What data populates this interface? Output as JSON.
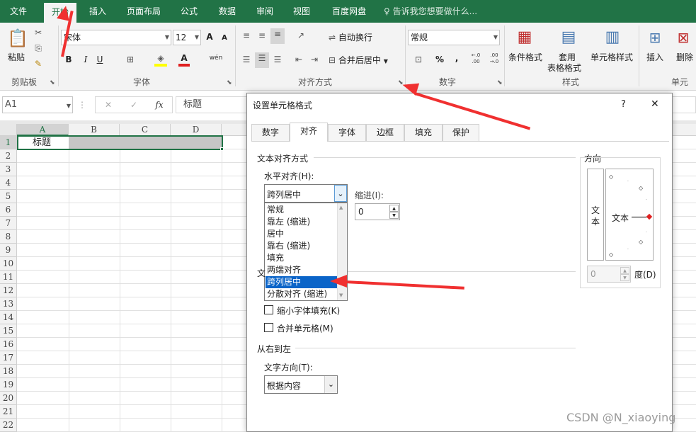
{
  "ribbon_tabs": [
    "文件",
    "开始",
    "插入",
    "页面布局",
    "公式",
    "数据",
    "审阅",
    "视图",
    "百度网盘"
  ],
  "active_tab": "开始",
  "tell_me": "告诉我您想要做什么...",
  "clipboard": {
    "paste": "粘贴",
    "group": "剪贴板"
  },
  "font": {
    "name": "宋体",
    "size": "12",
    "group": "字体",
    "bold": "B",
    "italic": "I",
    "underline": "U",
    "grow": "A",
    "shrink": "A",
    "wen": "wén"
  },
  "alignment": {
    "wrap": "自动换行",
    "merge": "合并后居中",
    "group": "对齐方式"
  },
  "number": {
    "format": "常规",
    "percent": "%",
    "comma": ",",
    "inc": "←.0 .00",
    "dec": ".00 →.0",
    "group": "数字"
  },
  "styles": {
    "cond": "条件格式",
    "table1": "套用",
    "table2": "表格格式",
    "cell": "单元格样式",
    "group": "样式"
  },
  "cells": {
    "insert": "插入",
    "delete": "删除",
    "group": "单元"
  },
  "formula_bar": {
    "name_box": "A1",
    "cancel": "✕",
    "enter": "✓",
    "fx": "fx",
    "value": "标题"
  },
  "sheet": {
    "columns": [
      "A",
      "B",
      "C",
      "D"
    ],
    "rows": [
      "1",
      "2",
      "3",
      "4",
      "5",
      "6",
      "7",
      "8",
      "9",
      "10",
      "11",
      "12",
      "13",
      "14",
      "15",
      "16",
      "17",
      "18",
      "19",
      "20",
      "21",
      "22"
    ],
    "a1": "标题"
  },
  "dialog": {
    "title": "设置单元格格式",
    "help": "?",
    "close": "✕",
    "tabs": [
      "数字",
      "对齐",
      "字体",
      "边框",
      "填充",
      "保护"
    ],
    "active_tab": "对齐",
    "text_align_section": "文本对齐方式",
    "horizontal_label": "水平对齐(H):",
    "horizontal_value": "跨列居中",
    "horizontal_options": [
      "常规",
      "靠左 (缩进)",
      "居中",
      "靠右 (缩进)",
      "填充",
      "两端对齐",
      "跨列居中",
      "分散对齐 (缩进)"
    ],
    "indent_label": "缩进(I):",
    "indent_value": "0",
    "text_control_partial": "文",
    "shrink_label": "缩小字体填充(K)",
    "merge_label": "合并单元格(M)",
    "rtl_section": "从右到左",
    "text_direction_label": "文字方向(T):",
    "text_direction_value": "根据内容",
    "orientation_section": "方向",
    "vertical_text": "文本",
    "horizontal_text": "文本",
    "degree_value": "0",
    "degree_label": "度(D)"
  },
  "watermark": "CSDN @N_xiaoying",
  "colors": {
    "excel_green": "#217346",
    "select_blue": "#0a64c8",
    "arrow_red": "#f03030"
  }
}
